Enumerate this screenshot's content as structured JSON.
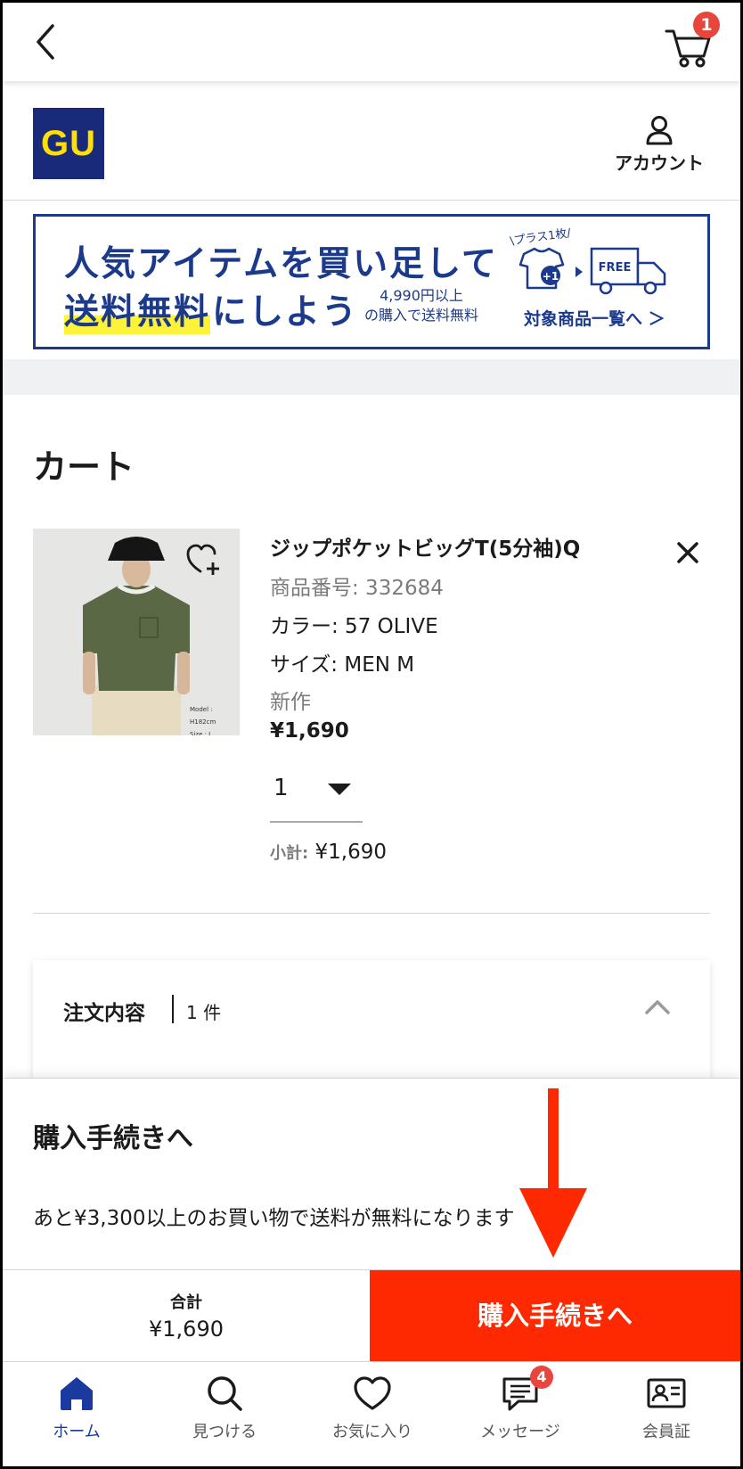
{
  "topbar": {
    "cart_badge": "1"
  },
  "header": {
    "logo_text": "GU",
    "account_label": "アカウント"
  },
  "banner": {
    "line1": "人気アイテムを買い足して",
    "line2_highlight": "送料無料",
    "line2_rest": "にしよう",
    "condition_line1": "4,990円以上",
    "condition_line2": "の購入で送料無料",
    "plus_caption": "\\プラス1枚/",
    "plus_badge": "+1",
    "free_label": "FREE",
    "link_label": "対象商品一覧へ ＞"
  },
  "cart": {
    "title": "カート",
    "item": {
      "name": "ジップポケットビッグT(5分袖)Q",
      "product_number": "商品番号: 332684",
      "color": "カラー: 57 OLIVE",
      "size": "サイズ: MEN M",
      "tag": "新作",
      "price": "¥1,690",
      "quantity": "1",
      "subtotal_label": "小計:",
      "subtotal_value": "¥1,690",
      "image_caption_1": "Model : H182cm",
      "image_caption_2": "Size : L"
    }
  },
  "order_summary": {
    "title": "注文内容",
    "count": "1 件"
  },
  "checkout": {
    "title": "購入手続きへ",
    "shipping_message": "あと¥3,300以上のお買い物で送料が無料になります",
    "total_label": "合計",
    "total_value": "¥1,690",
    "button_label": "購入手続きへ"
  },
  "colors": {
    "brand_navy": "#1a2a7a",
    "logo_yellow": "#ffe000",
    "cta_red": "#fe2900",
    "badge_red": "#e8453c",
    "nav_active": "#1b3aa0"
  },
  "bottom_nav": {
    "items": [
      {
        "label": "ホーム",
        "icon": "home-icon",
        "active": true
      },
      {
        "label": "見つける",
        "icon": "search-icon"
      },
      {
        "label": "お気に入り",
        "icon": "heart-icon"
      },
      {
        "label": "メッセージ",
        "icon": "message-icon",
        "badge": "4"
      },
      {
        "label": "会員証",
        "icon": "member-card-icon"
      }
    ]
  }
}
